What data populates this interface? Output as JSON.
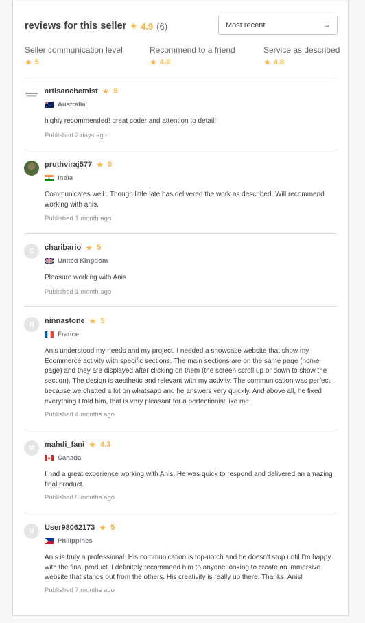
{
  "header": {
    "title": "reviews for this seller",
    "rating": "4.9",
    "count": "(6)"
  },
  "sort": {
    "label": "Most recent"
  },
  "metrics": [
    {
      "label": "Seller communication level",
      "value": "5"
    },
    {
      "label": "Recommend to a friend",
      "value": "4.8"
    },
    {
      "label": "Service as described",
      "value": "4.8"
    }
  ],
  "reviews": [
    {
      "username": "artisanchemist",
      "rating": "5",
      "country": "Australia",
      "initial": "",
      "text": "highly recommended! great coder and attention to detail!",
      "published": "Published 2 days ago"
    },
    {
      "username": "pruthviraj577",
      "rating": "5",
      "country": "India",
      "initial": "",
      "text": "Communicates well.. Though little late has delivered the work as described. Will recommend working with anis.",
      "published": "Published 1 month ago"
    },
    {
      "username": "charibario",
      "rating": "5",
      "country": "United Kingdom",
      "initial": "C",
      "text": "Pleasure working with Anis",
      "published": "Published 1 month ago"
    },
    {
      "username": "ninnastone",
      "rating": "5",
      "country": "France",
      "initial": "N",
      "text": "Anis understood my needs and my project. I needed a showcase website that show my Ecommerce activity with specific sections. The main sections are on the same page (home page) and they are displayed after clicking on them (the screen scroll up or down to show the section). The design is aesthetic and relevant with my activity. The communication was perfect because we chatted a lot on whatsapp and he answers very quickly. And above all, he fixed everything I told him, that is very pleasant for a perfectionist like me.",
      "published": "Published 4 months ago"
    },
    {
      "username": "mahdi_fani",
      "rating": "4.3",
      "country": "Canada",
      "initial": "M",
      "text": "I had a great experience working with Anis. He was quick to respond and delivered an amazing final product.",
      "published": "Published 5 months ago"
    },
    {
      "username": "User98062173",
      "rating": "5",
      "country": "Philippines",
      "initial": "U",
      "text": "Anis is truly a professional. His communication is top-notch and he doesn't stop until I'm happy with the final product. I definitely recommend him to anyone looking to create an immersive website that stands out from the others. His creativity is really up there. Thanks, Anis!",
      "published": "Published 7 months ago"
    }
  ]
}
